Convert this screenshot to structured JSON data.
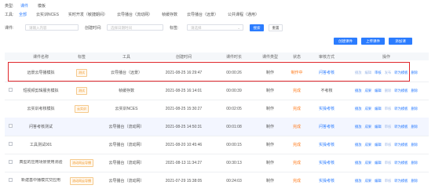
{
  "filters": {
    "type": {
      "label": "类型:",
      "options": [
        "课件",
        "模板"
      ]
    },
    "tool": {
      "label": "工具:",
      "options": [
        "全部",
        "云实训NCES",
        "实时开发（敏捷期间）",
        "云导播台（流动网）",
        "帧缓存数",
        "云导播台（远景）",
        "公共课程（通用）"
      ]
    },
    "course": {
      "label": "课件:",
      "placeholder": "请输入内容"
    },
    "created": {
      "label": "创建时间:",
      "placeholder": "选择日期时间"
    },
    "tag": {
      "label": "标签:",
      "placeholder": "请选择"
    },
    "search_label": "搜索",
    "reset_label": "重置"
  },
  "actions": {
    "create": "创建课件",
    "upload": "上传课件",
    "add": "添加课"
  },
  "table": {
    "headers": [
      "课件名称",
      "标签",
      "工具",
      "创建时间",
      "课件时长",
      "课件类型",
      "状态",
      "审核方式",
      "操作"
    ],
    "rows": [
      {
        "name": "远景云导播模拟",
        "tag": "测试",
        "tool": "云导播台（远景）",
        "created": "2021-08-25 16:29:47",
        "duration": "00:00:26",
        "type": "制作",
        "status": "制作中",
        "review": "问答考核",
        "ops": [
          "播放",
          "编辑",
          "审核",
          "发布",
          "转为模板",
          "删除"
        ]
      },
      {
        "name": "短视频剪辑服务模拟",
        "tag": "测试",
        "tool": "帧缓存数",
        "created": "2021-08-25 16:14:01",
        "duration": "00:00:39",
        "type": "制作",
        "status": "完成",
        "review": "不考核",
        "ops": [
          "播放",
          "成果",
          "编辑",
          "删除",
          "转为模板",
          "删除"
        ]
      },
      {
        "name": "云实训考核模拟",
        "tag": "云实训",
        "tool": "云实训NCES",
        "created": "2021-08-25 15:30:27",
        "duration": "00:02:05",
        "type": "制作",
        "status": "完成",
        "review": "实操考核",
        "ops": [
          "播放",
          "成果",
          "编辑",
          "审核",
          "转为模板",
          "删除"
        ]
      },
      {
        "name": "问答考核测试",
        "tag": "",
        "tool": "云导播台（流动网）",
        "created": "2021-08-25 14:50:31",
        "duration": "00:01:08",
        "type": "制作",
        "status": "完成",
        "review": "问答考核",
        "ops": [
          "播放",
          "成果",
          "编辑",
          "审核",
          "转为模板",
          "删除"
        ]
      },
      {
        "name": "工具测试001",
        "tag": "",
        "tool": "云导播台（流动网）",
        "created": "2021-08-20 10:45:46",
        "duration": "00:00:15",
        "type": "制作",
        "status": "完成",
        "review": "实操考核",
        "ops": [
          "播放",
          "成果",
          "编辑",
          "审核",
          "转为模板",
          "删除"
        ]
      },
      {
        "name": "典型的应用场景使用测验",
        "tag": "流动网云导播",
        "tool": "云导播台（流动网）",
        "created": "2021-08-13 11:34:27",
        "duration": "00:30:13",
        "type": "制作",
        "status": "完成",
        "review": "实操考核",
        "ops": [
          "播放",
          "成果",
          "编辑",
          "审核",
          "转为模板",
          "删除"
        ]
      },
      {
        "name": "新建基中播模式交应用",
        "tag": "流动网云导播",
        "tool": "云导播台（流动网）",
        "created": "2021-07-29 15:38:05",
        "duration": "00:24:03",
        "type": "制作",
        "status": "完成",
        "review": "实操考核",
        "ops": [
          "播放",
          "成果",
          "编辑",
          "审核",
          "转为模板",
          "删除"
        ]
      }
    ]
  },
  "colors": {
    "accent": "#2b7cff",
    "highlight": "#e0262b",
    "status_orange": "#ff7a1a"
  }
}
